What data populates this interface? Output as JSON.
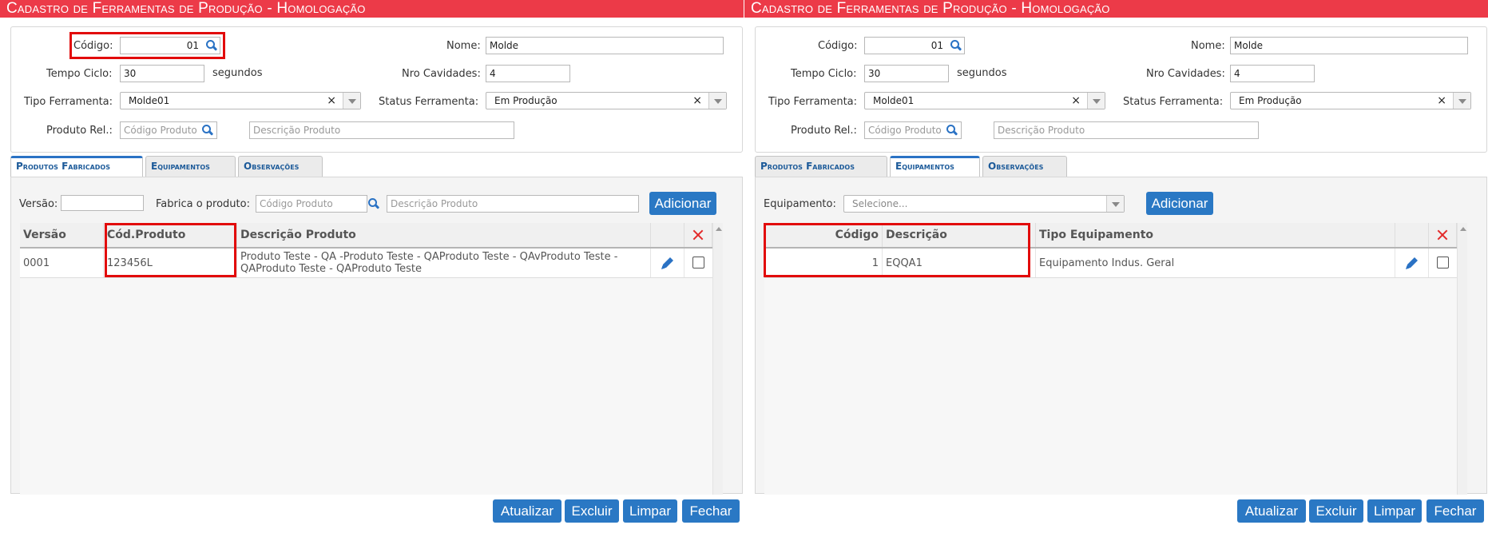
{
  "colors": {
    "title_bar": "#ec3a48",
    "accent_button": "#2a78c4",
    "tab_text": "#1c5a99",
    "highlight_box": "#e20b0b",
    "delete_icon": "#e32a2a"
  },
  "panels": [
    {
      "title": "Cadastro de Ferramentas de Produção  - Homologação",
      "form": {
        "codigo_label": "Código:",
        "codigo_value": "01",
        "nome_label": "Nome:",
        "nome_value": "Molde",
        "tempo_label": "Tempo Ciclo:",
        "tempo_value": "30",
        "tempo_unit": "segundos",
        "cavidades_label": "Nro Cavidades:",
        "cavidades_value": "4",
        "tipo_label": "Tipo Ferramenta:",
        "tipo_value": "Molde01",
        "status_label": "Status Ferramenta:",
        "status_value": "Em Produção",
        "produto_label": "Produto Rel.:",
        "produto_codigo_placeholder": "Código Produto",
        "produto_desc_placeholder": "Descrição Produto"
      },
      "tabs": [
        "Produtos Fabricados",
        "Equipamentos",
        "Observações"
      ],
      "active_tab": 0,
      "filter": {
        "versao_label": "Versão:",
        "fabrica_label": "Fabrica o produto:",
        "codigo_placeholder": "Código Produto",
        "desc_placeholder": "Descrição Produto",
        "add_label": "Adicionar"
      },
      "grid": {
        "headers": [
          "Versão",
          "Cód.Produto",
          "Descrição Produto"
        ],
        "rows": [
          {
            "versao": "0001",
            "codigo": "123456L",
            "descricao": "Produto Teste - QA -Produto Teste - QAProduto Teste - QAvProduto Teste - QAProduto Teste - QAProduto Teste"
          }
        ]
      },
      "buttons": [
        "Atualizar",
        "Excluir",
        "Limpar",
        "Fechar"
      ]
    },
    {
      "title": "Cadastro de Ferramentas de Produção  - Homologação",
      "form": {
        "codigo_label": "Código:",
        "codigo_value": "01",
        "nome_label": "Nome:",
        "nome_value": "Molde",
        "tempo_label": "Tempo Ciclo:",
        "tempo_value": "30",
        "tempo_unit": "segundos",
        "cavidades_label": "Nro Cavidades:",
        "cavidades_value": "4",
        "tipo_label": "Tipo Ferramenta:",
        "tipo_value": "Molde01",
        "status_label": "Status Ferramenta:",
        "status_value": "Em Produção",
        "produto_label": "Produto Rel.:",
        "produto_codigo_placeholder": "Código Produto",
        "produto_desc_placeholder": "Descrição Produto"
      },
      "tabs": [
        "Produtos Fabricados",
        "Equipamentos",
        "Observações"
      ],
      "active_tab": 1,
      "filter": {
        "equipamento_label": "Equipamento:",
        "equipamento_placeholder": "Selecione...",
        "add_label": "Adicionar"
      },
      "grid": {
        "headers": [
          "Código",
          "Descrição",
          "Tipo Equipamento"
        ],
        "rows": [
          {
            "codigo": "1",
            "descricao": "EQQA1",
            "tipo": "Equipamento Indus. Geral"
          }
        ]
      },
      "buttons": [
        "Atualizar",
        "Excluir",
        "Limpar",
        "Fechar"
      ]
    }
  ]
}
